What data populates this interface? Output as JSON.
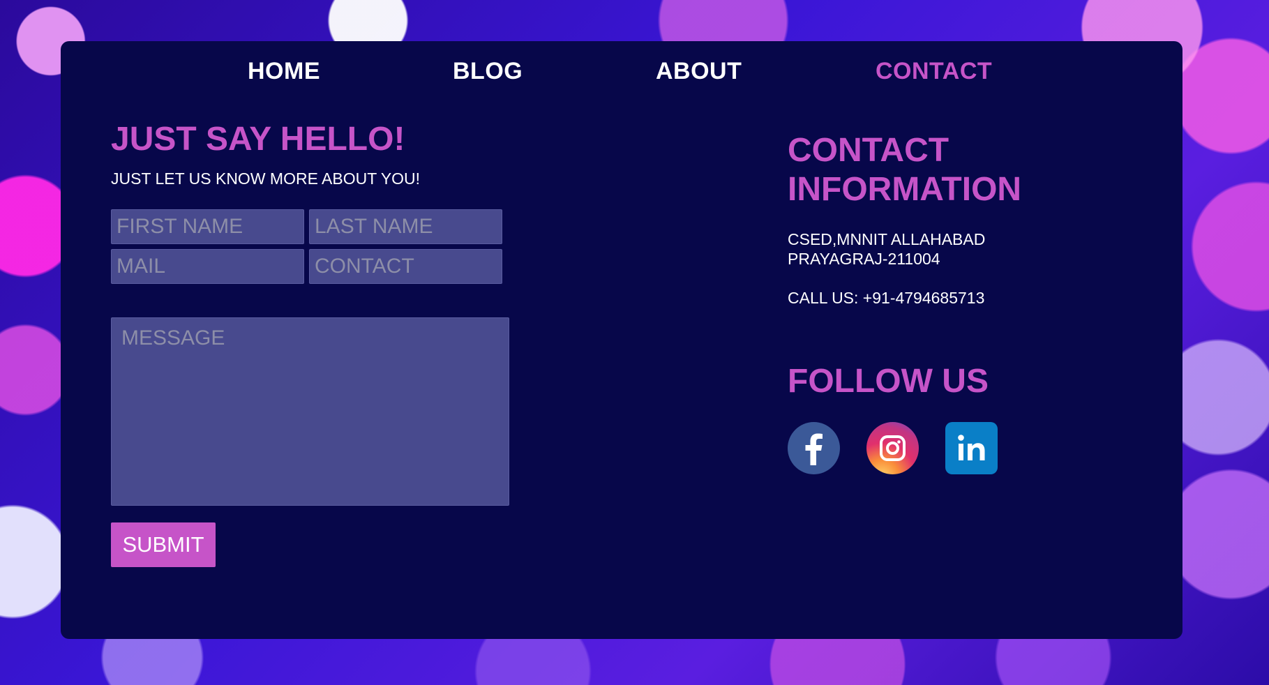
{
  "nav": {
    "items": [
      {
        "label": "HOME"
      },
      {
        "label": "BLOG"
      },
      {
        "label": "ABOUT"
      },
      {
        "label": "CONTACT",
        "active": true
      }
    ]
  },
  "form": {
    "title": "JUST SAY HELLO!",
    "subtitle": "JUST LET US KNOW MORE ABOUT YOU!",
    "first_name_placeholder": "FIRST NAME",
    "last_name_placeholder": "LAST NAME",
    "mail_placeholder": "MAIL",
    "contact_placeholder": "CONTACT",
    "message_placeholder": "MESSAGE",
    "submit_label": "SUBMIT"
  },
  "info": {
    "title": "CONTACT INFORMATION",
    "address_line1": "CSED,MNNIT ALLAHABAD",
    "address_line2": "PRAYAGRAJ-211004",
    "call": "CALL US: +91-4794685713"
  },
  "follow": {
    "title": "FOLLOW US",
    "icons": [
      "facebook-icon",
      "instagram-icon",
      "linkedin-icon"
    ]
  },
  "colors": {
    "accent": "#c654c8",
    "panel": "#07074a",
    "field_bg": "#484a8e",
    "facebook": "#3b5998",
    "linkedin": "#0a7fc7"
  }
}
